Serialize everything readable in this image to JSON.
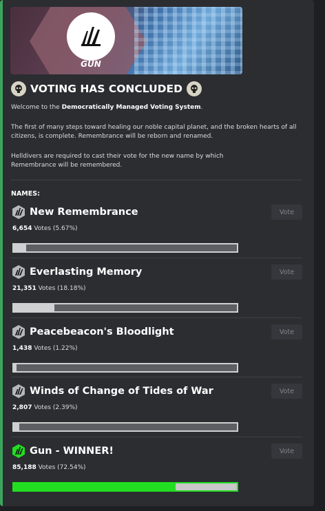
{
  "banner": {
    "logo_text": "GUN"
  },
  "heading": "VOTING HAS CONCLUDED",
  "intro": {
    "welcome_prefix": "Welcome to the ",
    "welcome_bold": "Democratically Managed Voting System",
    "welcome_suffix": ".",
    "para2_line1": "The first of many steps toward healing our noble capital planet, and the broken hearts of all",
    "para2_line2": "citizens, is complete. Remembrance will be reborn and renamed.",
    "para3_line1": "Helldivers are required to cast their vote for the new name by which",
    "para3_line2": "Remembrance will be remembered."
  },
  "names_label": "NAMES:",
  "vote_label": "Vote",
  "options": [
    {
      "name": "New Remembrance",
      "votes": "6,654",
      "votes_suffix": " Votes (5.67%)",
      "fraction": 0.0567,
      "winner": false
    },
    {
      "name": "Everlasting Memory",
      "votes": "21,351",
      "votes_suffix": " Votes (18.18%)",
      "fraction": 0.1818,
      "winner": false
    },
    {
      "name": "Peacebeacon's Bloodlight",
      "votes": "1,438",
      "votes_suffix": " Votes (1.22%)",
      "fraction": 0.0122,
      "winner": false
    },
    {
      "name": "Winds of Change of Tides of War",
      "votes": "2,807",
      "votes_suffix": " Votes (2.39%)",
      "fraction": 0.0239,
      "winner": false
    },
    {
      "name": "Gun - WINNER!",
      "votes": "85,188",
      "votes_suffix": " Votes (72.54%)",
      "fraction": 0.7254,
      "winner": true
    }
  ],
  "colors": {
    "accent": "#3ba55c",
    "winner": "#22dd22",
    "background": "#2b2d31"
  }
}
